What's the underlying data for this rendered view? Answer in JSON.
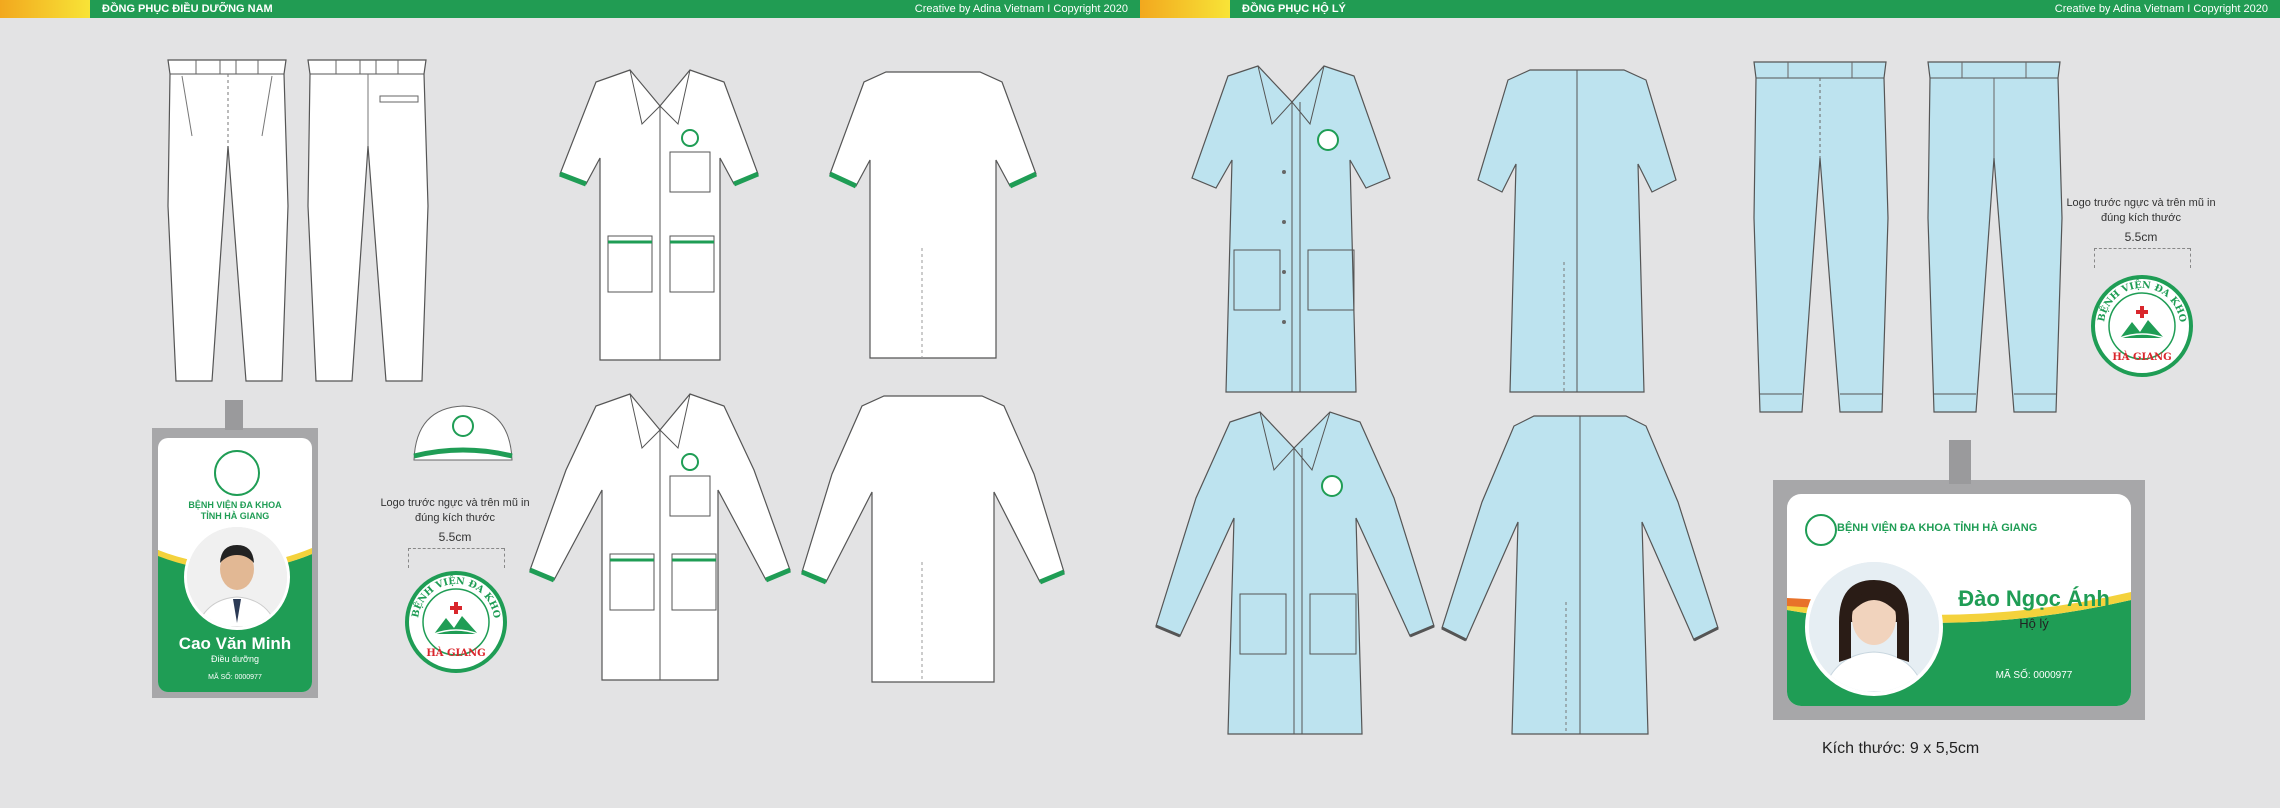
{
  "headers": {
    "left": {
      "title": "ĐỒNG PHỤC ĐIỀU DƯỠNG NAM",
      "credit": "Creative by Adina Vietnam I Copyright 2020"
    },
    "right": {
      "title": "ĐỒNG PHỤC HỘ LÝ",
      "credit": "Creative by Adina Vietnam I Copyright 2020"
    }
  },
  "logo_notes": {
    "left": {
      "line1": "Logo trước ngực và trên mũ in",
      "line2": "đúng kích thước",
      "size": "5.5cm"
    },
    "right": {
      "line1": "Logo trước ngực và trên mũ in",
      "line2": "đúng kích thước",
      "size": "5.5cm"
    }
  },
  "seal": {
    "arc_text": "BỆNH VIỆN ĐA KHOA TỈNH",
    "bottom_text": "HÀ GIANG"
  },
  "vertical_badge": {
    "hospital_line1": "BỆNH VIỆN ĐA KHOA",
    "hospital_line2": "TỈNH HÀ GIANG",
    "name": "Cao Văn Minh",
    "role": "Điều dưỡng",
    "code": "MÃ SỐ: 0000977"
  },
  "horizontal_badge": {
    "hospital": "BỆNH VIỆN ĐA KHOA TỈNH HÀ GIANG",
    "name": "Đào Ngọc Ánh",
    "role": "Hộ lý",
    "code": "MÃ SỐ: 0000977"
  },
  "size_label": "Kích thước: 9 x 5,5cm",
  "colors": {
    "brand_green": "#1f9d55",
    "header_green": "#219c53",
    "accent_yellow": "#f4d23c",
    "scrub_blue": "#bde3ef",
    "seal_red": "#d9262c"
  }
}
